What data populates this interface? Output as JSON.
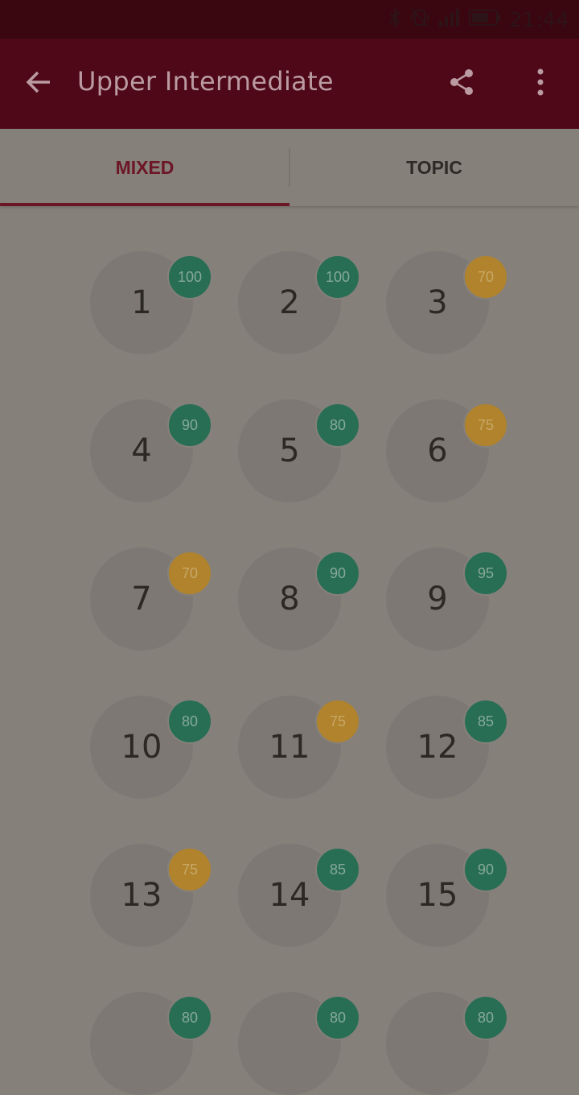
{
  "status_bar": {
    "time": "21:44",
    "icons": [
      "bluetooth-icon",
      "vibrate-icon",
      "signal-icon",
      "battery-icon"
    ]
  },
  "app_bar": {
    "title": "Upper Intermediate",
    "icons": [
      "back-arrow-icon",
      "share-icon",
      "more-vert-icon"
    ]
  },
  "tabs": [
    {
      "label": "MIXED",
      "selected": true
    },
    {
      "label": "TOPIC",
      "selected": false
    }
  ],
  "colors": {
    "appbar": "#4f0817",
    "accent": "#6c1626",
    "badge_high": "#276e55",
    "badge_mid": "#b0832c"
  },
  "lessons": [
    {
      "number": "1",
      "score": "100",
      "level": "green"
    },
    {
      "number": "2",
      "score": "100",
      "level": "green"
    },
    {
      "number": "3",
      "score": "70",
      "level": "gold"
    },
    {
      "number": "4",
      "score": "90",
      "level": "green"
    },
    {
      "number": "5",
      "score": "80",
      "level": "green"
    },
    {
      "number": "6",
      "score": "75",
      "level": "gold"
    },
    {
      "number": "7",
      "score": "70",
      "level": "gold"
    },
    {
      "number": "8",
      "score": "90",
      "level": "green"
    },
    {
      "number": "9",
      "score": "95",
      "level": "green"
    },
    {
      "number": "10",
      "score": "80",
      "level": "green"
    },
    {
      "number": "11",
      "score": "75",
      "level": "gold"
    },
    {
      "number": "12",
      "score": "85",
      "level": "green"
    },
    {
      "number": "13",
      "score": "75",
      "level": "gold"
    },
    {
      "number": "14",
      "score": "85",
      "level": "green"
    },
    {
      "number": "15",
      "score": "90",
      "level": "green"
    },
    {
      "number": "",
      "score": "80",
      "level": "green"
    },
    {
      "number": "",
      "score": "80",
      "level": "green"
    },
    {
      "number": "",
      "score": "80",
      "level": "green"
    }
  ]
}
